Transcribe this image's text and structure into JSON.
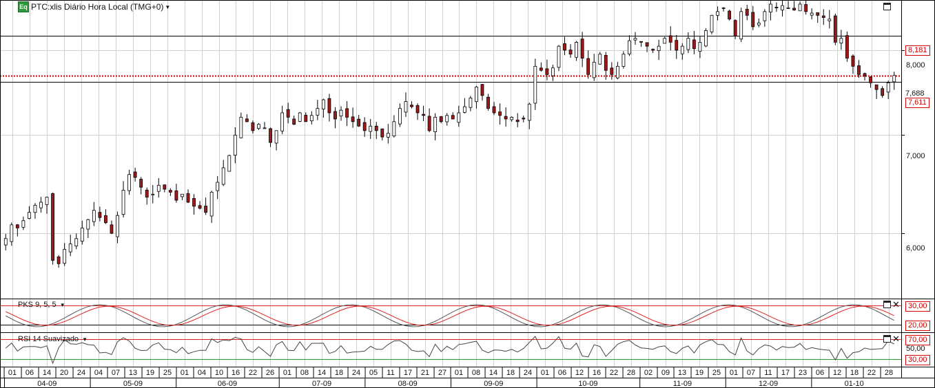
{
  "header": {
    "badge": "Eq",
    "title": "PTC:xlis Diário Hora Local (TMG+0)"
  },
  "price_axis": {
    "ticks": [
      "8,000",
      "7,000",
      "6,000"
    ],
    "tags": {
      "upper": "8,181",
      "last": "7,688",
      "lower": "7,611"
    }
  },
  "pks_pane": {
    "label": "PKS 9, 5, 5",
    "levels": [
      "30,00",
      "20,00"
    ]
  },
  "rsi_pane": {
    "label": "RSI 14 Suavizado",
    "levels": [
      "70,00",
      "50,00",
      "30,00"
    ]
  },
  "x_axis": {
    "days": [
      "01",
      "06",
      "14",
      "20",
      "24",
      "04",
      "07",
      "13",
      "19",
      "25",
      "01",
      "04",
      "10",
      "16",
      "22",
      "26",
      "01",
      "08",
      "14",
      "18",
      "24",
      "05",
      "11",
      "17",
      "21",
      "27",
      "01",
      "08",
      "14",
      "18",
      "24",
      "01",
      "06",
      "12",
      "16",
      "22",
      "28",
      "02",
      "09",
      "13",
      "19",
      "25",
      "01",
      "07",
      "11",
      "17",
      "23",
      "06",
      "12",
      "18",
      "22",
      "28"
    ],
    "months": [
      "04-09",
      "05-09",
      "06-09",
      "07-09",
      "08-09",
      "09-09",
      "10-09",
      "11-09",
      "12-09",
      "01-10"
    ]
  },
  "colors": {
    "bull": "#ffffff",
    "bear": "#a01818",
    "outline": "#000000",
    "signal": "#e02020",
    "dotted_line": "#d00000",
    "grid": "#cfcfcf"
  },
  "chart_data": {
    "type": "candlestick",
    "y_scale": "log",
    "ylim": [
      5.45,
      8.6
    ],
    "horizontal_lines": [
      8.181,
      7.611
    ],
    "last_price": 7.688,
    "close": [
      5.95,
      6.08,
      6.05,
      6.12,
      6.2,
      6.27,
      6.3,
      6.35,
      5.75,
      5.72,
      5.85,
      5.9,
      5.95,
      6.05,
      6.13,
      6.22,
      6.15,
      6.1,
      6.0,
      6.17,
      6.42,
      6.58,
      6.55,
      6.45,
      6.35,
      6.38,
      6.47,
      6.43,
      6.4,
      6.32,
      6.38,
      6.3,
      6.26,
      6.24,
      6.2,
      6.4,
      6.5,
      6.65,
      6.78,
      7.0,
      7.2,
      7.15,
      7.05,
      7.12,
      7.08,
      6.92,
      7.05,
      7.25,
      7.2,
      7.12,
      7.25,
      7.15,
      7.22,
      7.3,
      7.4,
      7.25,
      7.18,
      7.28,
      7.2,
      7.15,
      7.1,
      7.05,
      7.1,
      7.05,
      6.98,
      7.02,
      7.15,
      7.3,
      7.38,
      7.32,
      7.25,
      7.22,
      7.05,
      7.2,
      7.15,
      7.22,
      7.18,
      7.25,
      7.32,
      7.42,
      7.55,
      7.45,
      7.3,
      7.25,
      7.22,
      7.18,
      7.2,
      7.15,
      7.18,
      7.35,
      7.8,
      7.75,
      7.7,
      7.78,
      8.05,
      8.0,
      7.95,
      8.1,
      7.9,
      7.7,
      7.85,
      7.95,
      7.75,
      7.7,
      7.8,
      7.95,
      8.12,
      8.15,
      8.1,
      8.05,
      8.0,
      8.05,
      8.15,
      8.1,
      8.0,
      8.05,
      8.15,
      8.02,
      8.1,
      8.25,
      8.45,
      8.5,
      8.55,
      8.4,
      8.18,
      8.5,
      8.45,
      8.3,
      8.35,
      8.5,
      8.6,
      8.55,
      8.58,
      8.55,
      8.52,
      8.6,
      8.5,
      8.48,
      8.45,
      8.42,
      8.4,
      8.1,
      8.15,
      7.9,
      7.8,
      7.7,
      7.68,
      7.6,
      7.52,
      7.45,
      7.6,
      7.688
    ],
    "signal_levels": {
      "pks": [
        30,
        20
      ],
      "rsi": [
        70,
        50,
        30
      ]
    }
  }
}
